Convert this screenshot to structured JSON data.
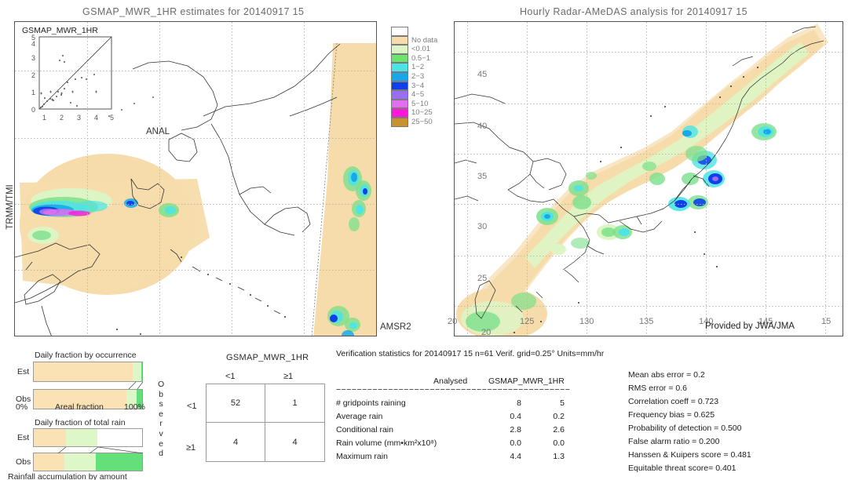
{
  "panels": {
    "left": {
      "title": "GSMAP_MWR_1HR estimates for 20140917 15",
      "inset_label": "GSMAP_MWR_1HR",
      "inset_axis_ticks": [
        "0",
        "1",
        "2",
        "3",
        "4",
        "5"
      ],
      "anal_label": "ANAL",
      "sensor_label_bottom": "AMSR2",
      "sensor_label_side": "TRMM/TMI"
    },
    "right": {
      "title": "Hourly Radar-AMeDAS analysis for 20140917 15",
      "credit": "Provided by JWA/JMA",
      "lat_ticks": [
        "45",
        "40",
        "35",
        "30",
        "25",
        "20"
      ],
      "lon_ticks": [
        "125",
        "130",
        "135",
        "140",
        "145",
        "15"
      ],
      "corner_lat": "20",
      "bottom_lat": "20"
    }
  },
  "legend": {
    "entries": [
      {
        "label": "",
        "color": "#ffffff"
      },
      {
        "label": "No data",
        "color": "#f7dcab"
      },
      {
        "label": "<0.01",
        "color": "#ddf5c4"
      },
      {
        "label": "0.5−1",
        "color": "#6ee46e"
      },
      {
        "label": "1−2",
        "color": "#4ce4e4"
      },
      {
        "label": "2−3",
        "color": "#18a8e8"
      },
      {
        "label": "3−4",
        "color": "#1040e8"
      },
      {
        "label": "4−5",
        "color": "#9a6ef0"
      },
      {
        "label": "5−10",
        "color": "#e46ef0"
      },
      {
        "label": "10−25",
        "color": "#ff18d8"
      },
      {
        "label": "25−50",
        "color": "#c8922c"
      }
    ]
  },
  "fraction_charts": [
    {
      "title": "Daily fraction by occurrence",
      "row_labels": [
        "Est",
        "Obs"
      ],
      "scale_left": "0%",
      "scale_center": "Areal fraction",
      "scale_right": "100%",
      "est_segments": [
        {
          "frac": 0.915,
          "color": "#fbe2b5"
        },
        {
          "frac": 0.075,
          "color": "#ddf7c9"
        },
        {
          "frac": 0.01,
          "color": "#64e07a"
        }
      ],
      "obs_segments": [
        {
          "frac": 0.858,
          "color": "#fbe2b5"
        },
        {
          "frac": 0.088,
          "color": "#ddf7c9"
        },
        {
          "frac": 0.054,
          "color": "#64e07a"
        }
      ]
    },
    {
      "title": "Daily fraction of total rain",
      "row_labels": [
        "Est",
        "Obs"
      ],
      "caption": "Rainfall accumulation by amount",
      "est_segments": [
        {
          "frac": 0.3,
          "color": "#fbe2b5"
        },
        {
          "frac": 0.29,
          "color": "#ddf7c9"
        }
      ],
      "obs_segments": [
        {
          "frac": 0.285,
          "color": "#fbe2b5"
        },
        {
          "frac": 0.285,
          "color": "#ddf7c9"
        },
        {
          "frac": 0.43,
          "color": "#64e07a"
        }
      ]
    }
  ],
  "contingency": {
    "title": "GSMAP_MWR_1HR",
    "col_headers": [
      "<1",
      "≥1"
    ],
    "row_headers": [
      "<1",
      "≥1"
    ],
    "axis_label": "Observed",
    "cells": [
      [
        "52",
        "1"
      ],
      [
        "4",
        "4"
      ]
    ]
  },
  "verification": {
    "header": "Verification statistics for 20140917 15  n=61  Verif. grid=0.25°  Units=mm/hr",
    "dashes": "−−−−−−−−−−−−−−−−−−−−−−−−−−−−−−−−−−−−−−−−−−−−−",
    "col_head_1": "Analysed",
    "col_head_2": "GSMAP_MWR_1HR",
    "rows": [
      {
        "name": "# gridpoints raining",
        "analysed": "8",
        "model": "5"
      },
      {
        "name": "Average rain",
        "analysed": "0.4",
        "model": "0.2"
      },
      {
        "name": "Conditional rain",
        "analysed": "2.8",
        "model": "2.6"
      },
      {
        "name": "Rain volume (mm•km²x10⁸)",
        "analysed": "0.0",
        "model": "0.0"
      },
      {
        "name": "Maximum rain",
        "analysed": "4.4",
        "model": "1.3"
      }
    ],
    "scores": [
      "Mean abs error = 0.2",
      "RMS error = 0.6",
      "Correlation coeff = 0.723",
      "Frequency bias = 0.625",
      "Probability of detection = 0.500",
      "False alarm ratio = 0.200",
      "Hanssen & Kuipers score = 0.481",
      "Equitable threat score= 0.401"
    ]
  },
  "colors": {
    "nodata": "#f7dcab",
    "light_rain": "#ddf5c4",
    "frame": "#555555",
    "title_gray": "#6b6b6b"
  }
}
